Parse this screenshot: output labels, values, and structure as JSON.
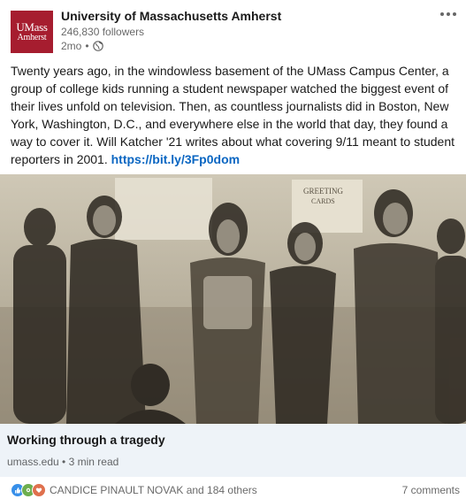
{
  "post": {
    "org_logo_line1": "UMass",
    "org_logo_line2": "Amherst",
    "org_name": "University of Massachusetts Amherst",
    "followers": "246,830 followers",
    "age": "2mo",
    "separator": "•",
    "visibility_icon": "globe-icon",
    "more_icon": "more-options-icon",
    "text": "Twenty years ago, in the windowless basement of the UMass Campus Center, a group of college kids running a student newspaper watched the biggest event of their lives unfold on television. Then, as countless journalists did in Boston, New York, Washington, D.C., and everywhere else in the world that day, they found a way to cover it. Will Katcher '21 writes about what covering 9/11 meant to student reporters in 2001. ",
    "link_text": "https://bit.ly/3Fp0dom"
  },
  "photo": {
    "sign_text_1": "GREETING",
    "sign_text_2": "CARDS"
  },
  "link_preview": {
    "title": "Working through a tragedy",
    "source": "umass.edu",
    "separator": "•",
    "read_time": "3 min read"
  },
  "social": {
    "reactors": "CANDICE PINAULT NOVAK and 184 others",
    "comments": "7 comments",
    "reaction_icons": [
      "like-icon",
      "celebrate-icon",
      "love-icon"
    ]
  },
  "colors": {
    "brand": "#a61d2f",
    "link": "#0a66c2",
    "preview_bg": "#eef3f8"
  }
}
